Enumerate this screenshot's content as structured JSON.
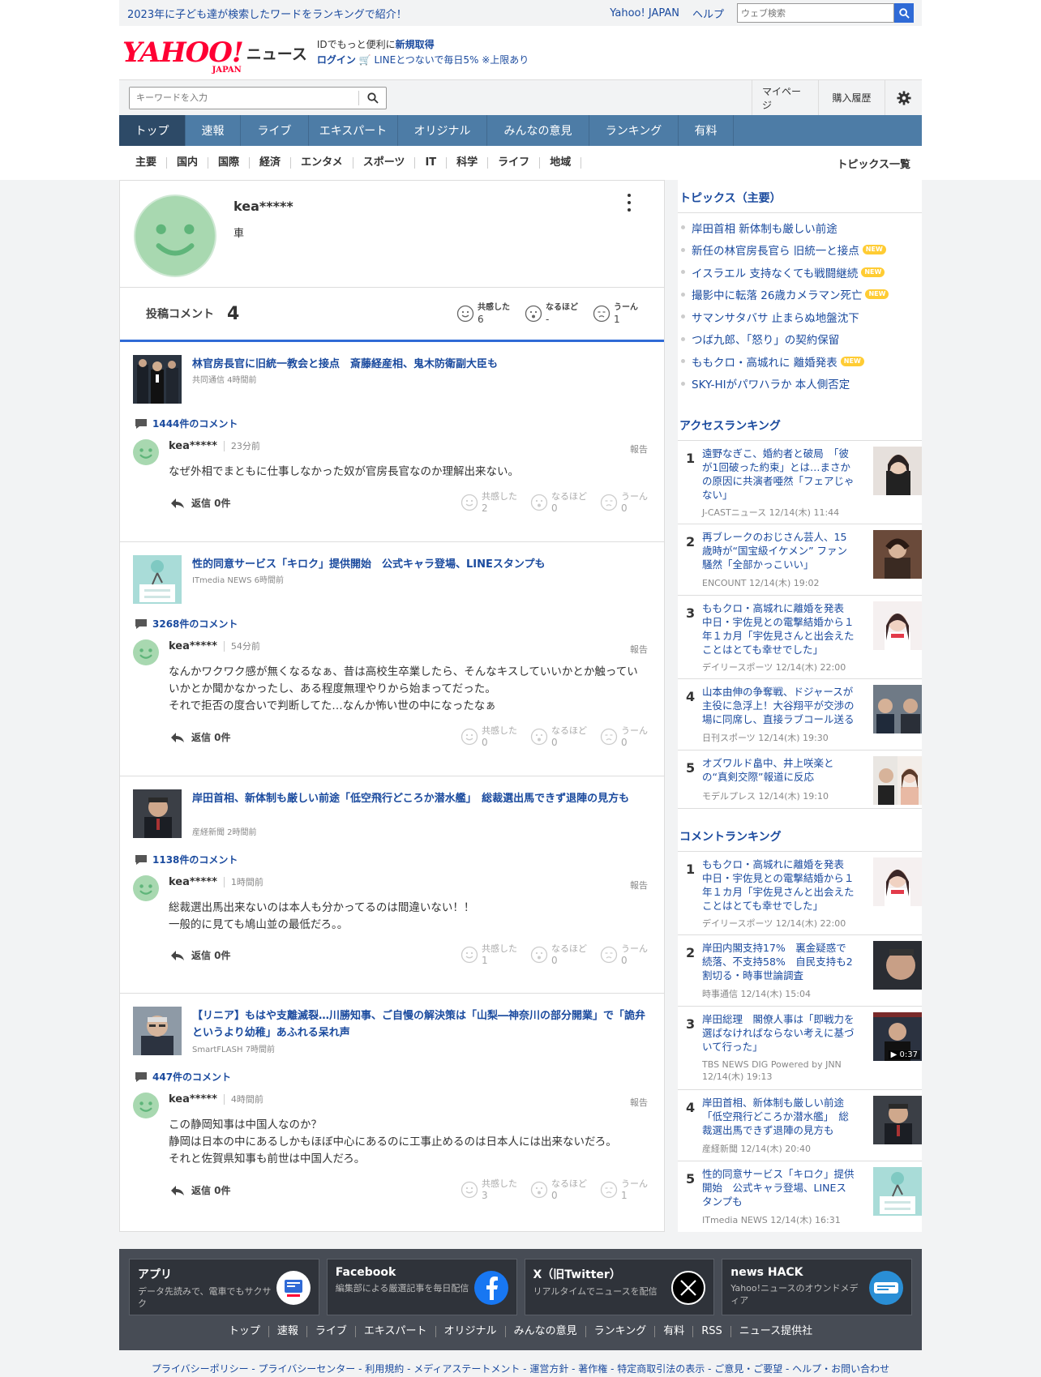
{
  "promo": {
    "text": "2023年に子ども達が検索したワードをランキングで紹介！",
    "yahoo_japan": "Yahoo! JAPAN",
    "help": "ヘルプ",
    "search_placeholder": "ウェブ検索"
  },
  "header": {
    "logo": "YAHOO!",
    "logo_sub": "JAPAN",
    "news": "ニュース",
    "id_text": "IDでもっと便利に",
    "id_link": "新規取得",
    "login": "ログイン",
    "line_text": "LINEとつないで毎日5% ※上限あり"
  },
  "searchbar": {
    "placeholder": "キーワードを入力",
    "mypage": "マイページ",
    "history": "購入履歴"
  },
  "gnav": [
    "トップ",
    "速報",
    "ライブ",
    "エキスパート",
    "オリジナル",
    "みんなの意見",
    "ランキング",
    "有料"
  ],
  "categories": [
    "主要",
    "国内",
    "国際",
    "経済",
    "エンタメ",
    "スポーツ",
    "IT",
    "科学",
    "ライフ",
    "地域"
  ],
  "topics_all": "トピックス一覧",
  "profile": {
    "name": "kea*****",
    "bio": "車",
    "stats_label": "投稿コメント",
    "stats_count": "4",
    "reactions": [
      {
        "label": "共感した",
        "value": "6"
      },
      {
        "label": "なるほど",
        "value": "-"
      },
      {
        "label": "うーん",
        "value": "1"
      }
    ]
  },
  "comments": [
    {
      "title": "林官房長官に旧統一教会と接点　斎藤経産相、鬼木防衛副大臣も",
      "source": "共同通信 4時間前",
      "count": "1444件のコメント",
      "user": "kea*****",
      "time": "23分前",
      "report": "報告",
      "body": "なぜ外相でまともに仕事しなかった奴が官房長官なのか理解出来ない。",
      "reply": "返信 0件",
      "reactions": [
        {
          "label": "共感した",
          "value": "2"
        },
        {
          "label": "なるほど",
          "value": "0"
        },
        {
          "label": "うーん",
          "value": "0"
        }
      ]
    },
    {
      "title": "性的同意サービス「キロク」提供開始　公式キャラ登場、LINEスタンプも",
      "source": "ITmedia NEWS 6時間前",
      "count": "3268件のコメント",
      "user": "kea*****",
      "time": "54分前",
      "report": "報告",
      "body": "なんかワクワク感が無くなるなぁ、昔は高校生卒業したら、そんなキスしていいかとか触っていいかとか聞かなかったし、ある程度無理やりから始まってだった。\nそれで拒否の度合いで判断してた…なんか怖い世の中になったなぁ",
      "reply": "返信 0件",
      "reactions": [
        {
          "label": "共感した",
          "value": "0"
        },
        {
          "label": "なるほど",
          "value": "0"
        },
        {
          "label": "うーん",
          "value": "0"
        }
      ]
    },
    {
      "title": "岸田首相、新体制も厳しい前途「低空飛行どころか潜水艦」　総裁選出馬できず退陣の見方も",
      "source": "産経新聞 2時間前",
      "count": "1138件のコメント",
      "user": "kea*****",
      "time": "1時間前",
      "report": "報告",
      "body": "総裁選出馬出来ないのは本人も分かってるのは間違いない！！\n一般的に見ても鳩山並の最低だろ。。",
      "reply": "返信 0件",
      "reactions": [
        {
          "label": "共感した",
          "value": "1"
        },
        {
          "label": "なるほど",
          "value": "0"
        },
        {
          "label": "うーん",
          "value": "0"
        }
      ]
    },
    {
      "title": "【リニア】もはや支離滅裂…川勝知事、ご自慢の解決策は「山梨―神奈川の部分開業」で「詭弁というより幼稚」あふれる呆れ声",
      "source": "SmartFLASH 7時間前",
      "count": "447件のコメント",
      "user": "kea*****",
      "time": "4時間前",
      "report": "報告",
      "body": "この静岡知事は中国人なのか？\n静岡は日本の中にあるしかもほぼ中心にあるのに工事止めるのは日本人には出来ないだろ。\nそれと佐賀県知事も前世は中国人だろ。",
      "reply": "返信 0件",
      "reactions": [
        {
          "label": "共感した",
          "value": "3"
        },
        {
          "label": "なるほど",
          "value": "0"
        },
        {
          "label": "うーん",
          "value": "1"
        }
      ]
    }
  ],
  "sidebar": {
    "topics_title": "トピックス（主要）",
    "topics": [
      {
        "text": "岸田首相 新体制も厳しい前途",
        "new": ""
      },
      {
        "text": "新任の林官房長官ら 旧統一と接点",
        "new": "NEW"
      },
      {
        "text": "イスラエル 支持なくても戦闘継続",
        "new": "NEW"
      },
      {
        "text": "撮影中に転落 26歳カメラマン死亡",
        "new": "NEW"
      },
      {
        "text": "サマンサタバサ 止まらぬ地盤沈下",
        "new": ""
      },
      {
        "text": "つば九郎、「怒り」の契約保留",
        "new": ""
      },
      {
        "text": "ももクロ・高城れに 離婚発表",
        "new": "NEW"
      },
      {
        "text": "SKY-HIがパワハラか 本人側否定",
        "new": ""
      }
    ],
    "access_title": "アクセスランキング",
    "access": [
      {
        "rank": "1",
        "title": "遠野なぎこ、婚約者と破局　「彼が1回破った約束」とは…まさかの原因に共演者唖然「フェアじゃない」",
        "meta": "J-CASTニュース 12/14(木) 11:44"
      },
      {
        "rank": "2",
        "title": "再ブレークのおじさん芸人、15歳時が“国宝級イケメン” ファン騒然「全部かっこいい」",
        "meta": "ENCOUNT 12/14(木) 19:02"
      },
      {
        "rank": "3",
        "title": "ももクロ・高城れに離婚を発表　中日・宇佐見との電撃結婚から１年１カ月「宇佐見さんと出会えたことはとても幸せでした」",
        "meta": "デイリースポーツ 12/14(木) 22:00"
      },
      {
        "rank": "4",
        "title": "山本由伸の争奪戦、ドジャースが主役に急浮上！大谷翔平が交渉の場に同席し、直接ラブコール送る",
        "meta": "日刊スポーツ 12/14(木) 19:30"
      },
      {
        "rank": "5",
        "title": "オズワルド畠中、井上咲楽との“真剣交際”報道に反応",
        "meta": "モデルプレス 12/14(木) 19:10"
      }
    ],
    "comment_title": "コメントランキング",
    "comment_rank": [
      {
        "rank": "1",
        "title": "ももクロ・高城れに離婚を発表　中日・宇佐見との電撃結婚から１年１カ月「宇佐見さんと出会えたことはとても幸せでした」",
        "meta": "デイリースポーツ 12/14(木) 22:00"
      },
      {
        "rank": "2",
        "title": "岸田内閣支持17%　裏金疑惑で続落、不支持58%　自民支持も2割切る・時事世論調査",
        "meta": "時事通信 12/14(木) 15:04"
      },
      {
        "rank": "3",
        "title": "岸田総理　閣僚人事は「即戦力を選ばなければならない考えに基づいて行った」",
        "meta": "TBS NEWS DIG Powered by JNN 12/14(木) 19:13",
        "video": "▶ 0:37"
      },
      {
        "rank": "4",
        "title": "岸田首相、新体制も厳しい前途「低空飛行どころか潜水艦」　総裁選出馬できず退陣の見方も",
        "meta": "産経新聞 12/14(木) 20:40"
      },
      {
        "rank": "5",
        "title": "性的同意サービス「キロク」提供開始　公式キャラ登場、LINEスタンプも",
        "meta": "ITmedia NEWS 12/14(木) 16:31"
      }
    ]
  },
  "footer": {
    "cards": [
      {
        "title": "アプリ",
        "desc": "データ先読みで、電車でもサクサク"
      },
      {
        "title": "Facebook",
        "desc": "編集部による厳選記事を毎日配信"
      },
      {
        "title": "X（旧Twitter）",
        "desc": "リアルタイムでニュースを配信"
      },
      {
        "title": "news HACK",
        "desc": "Yahoo!ニュースのオウンドメディア"
      }
    ],
    "links": [
      "トップ",
      "速報",
      "ライブ",
      "エキスパート",
      "オリジナル",
      "みんなの意見",
      "ランキング",
      "有料",
      "RSS",
      "ニュース提供社"
    ],
    "legal": "プライバシーポリシー - プライバシーセンター - 利用規約 - メディアステートメント - 運営方針 - 著作権 - 特定商取引法の表示 - ご意見・ご要望 - ヘルプ・お問い合わせ"
  }
}
